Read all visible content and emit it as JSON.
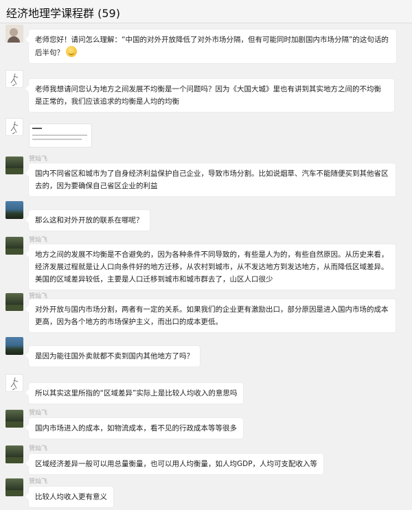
{
  "header": {
    "title": "经济地理学课程群 (59)"
  },
  "messages": [
    {
      "sender": "",
      "avatar": "face-avatar",
      "text": "老师您好！请问怎么理解：“中国的对外开放降低了对外市场分隔，但有可能同时加剧国内市场分隔”的这句话的后半句？",
      "emoji": "thinking-emoji-icon"
    },
    {
      "sender": "",
      "avatar": "sketch-avatar",
      "text": "老师我想请问您认为地方之间发展不均衡是一个问题吗？因为《大国大城》里也有讲到其实地方之间的不均衡是正常的，我们应该追求的均衡是人均的均衡"
    },
    {
      "sender": "",
      "avatar": "sketch-avatar",
      "image": "screenshot-thumbnail"
    },
    {
      "sender": "贺灿飞",
      "avatar": "photo-avatar",
      "text": "国内不同省区和城市为了自身经济利益保护自己企业，导致市场分割。比如说烟草、汽车不能随便买到其他省区去的，因为要确保自己省区企业的利益"
    },
    {
      "sender": "",
      "avatar": "sky-avatar",
      "text": "那么这和对外开放的联系在哪呢？"
    },
    {
      "sender": "贺灿飞",
      "avatar": "photo-avatar",
      "text": "地方之间的发展不均衡是不合避免的，因为各种条件不同导致的，有些是人为的，有些自然原因。从历史来看，经济发展过程就是让人口向条件好的地方迁移，从农村到城市，从不发达地方到发达地方，从而降低区域差异。美国的区域差异较低，主要是人口迁移到城市和城市群去了，山区人口很少"
    },
    {
      "sender": "贺灿飞",
      "avatar": "photo-avatar",
      "text": "对外开放与国内市场分割，两者有一定的关系。如果我们的企业更有激励出口，部分原因是进入国内市场的成本更高，因为各个地方的市场保护主义，而出口的成本更低。"
    },
    {
      "sender": "",
      "avatar": "sky-avatar",
      "text": "是因为能往国外卖就都不卖到国内其他地方了吗？"
    },
    {
      "sender": "",
      "avatar": "sketch-avatar",
      "text": "所以其实这里所指的“区域差异”实际上是比较人均收入的意思吗"
    },
    {
      "sender": "贺灿飞",
      "avatar": "photo-avatar",
      "text": "国内市场进入的成本，如物流成本，看不见的行政成本等等很多"
    },
    {
      "sender": "贺灿飞",
      "avatar": "photo-avatar",
      "text": "区域经济差异一般可以用总量衡量，也可以用人均衡量，如人均GDP，人均可支配收入等"
    },
    {
      "sender": "贺灿飞",
      "avatar": "photo-avatar",
      "text": "比较人均收入更有意义"
    }
  ]
}
